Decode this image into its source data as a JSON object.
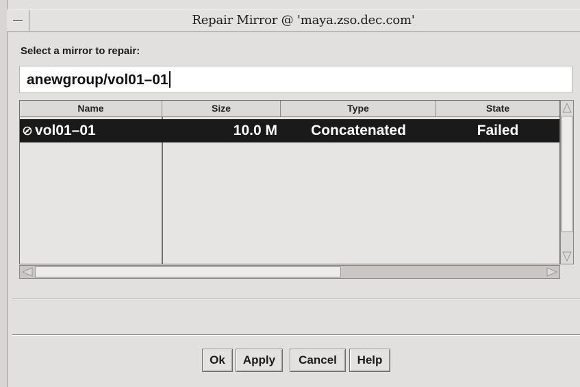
{
  "window": {
    "title": "Repair Mirror @ 'maya.zso.dec.com'"
  },
  "prompt": "Select a mirror to repair:",
  "selection_field": {
    "value": "anewgroup/vol01–01"
  },
  "table": {
    "columns": [
      "Name",
      "Size",
      "Type",
      "State"
    ],
    "rows": [
      {
        "name": "vol01–01",
        "size": "10.0 M",
        "type": "Concatenated",
        "state": "Failed",
        "icon": "volume-icon",
        "selected": true
      }
    ]
  },
  "buttons": {
    "ok": "Ok",
    "apply": "Apply",
    "cancel": "Cancel",
    "help": "Help"
  },
  "colors": {
    "selected_row_bg": "#1a1a1a",
    "selected_row_text": "#ffffff"
  }
}
